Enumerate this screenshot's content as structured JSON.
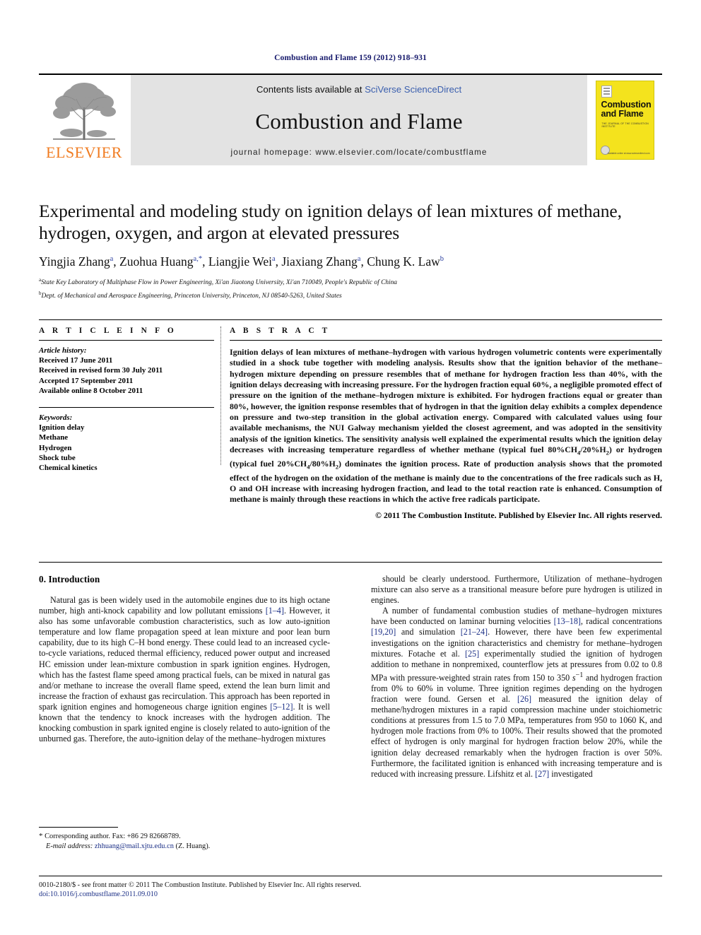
{
  "running_head": "Combustion and Flame 159 (2012) 918–931",
  "banner": {
    "publisher_logo_name": "elsevier-tree-logo",
    "publisher_wordmark": "ELSEVIER",
    "contents_prefix": "Contents lists available at ",
    "contents_link": "SciVerse ScienceDirect",
    "journal_title": "Combustion and Flame",
    "homepage": "journal homepage: www.elsevier.com/locate/combustflame",
    "cover": {
      "title_line1": "Combustion",
      "title_line2": "and Flame",
      "subtitle": "THE JOURNAL OF THE COMBUSTION INSTITUTE",
      "footer_note": "Available online at www.sciencedirect.com"
    }
  },
  "article": {
    "title": "Experimental and modeling study on ignition delays of lean mixtures of methane, hydrogen, oxygen, and argon at elevated pressures",
    "authors_html": "Yingjia Zhang<sup>a</sup>, Zuohua Huang<sup>a,</sup><sup>*</sup>, Liangjie Wei<sup>a</sup>, Jiaxiang Zhang<sup>a</sup>, Chung K. Law<sup>b</sup>",
    "affiliations": [
      {
        "marker": "a",
        "text": "State Key Laboratory of Multiphase Flow in Power Engineering, Xi'an Jiaotong University, Xi'an 710049, People's Republic of China"
      },
      {
        "marker": "b",
        "text": "Dept. of Mechanical and Aerospace Engineering, Princeton University, Princeton, NJ 08540-5263, United States"
      }
    ]
  },
  "info": {
    "heading": "A R T I C L E   I N F O",
    "history_label": "Article history:",
    "history": [
      "Received 17 June 2011",
      "Received in revised form 30 July 2011",
      "Accepted 17 September 2011",
      "Available online 8 October 2011"
    ],
    "keywords_label": "Keywords:",
    "keywords": [
      "Ignition delay",
      "Methane",
      "Hydrogen",
      "Shock tube",
      "Chemical kinetics"
    ]
  },
  "abstract": {
    "heading": "A B S T R A C T",
    "body_html": "Ignition delays of lean mixtures of methane–hydrogen with various hydrogen volumetric contents were experimentally studied in a shock tube together with modeling analysis. Results show that the ignition behavior of the methane–hydrogen mixture depending on pressure resembles that of methane for hydrogen fraction less than 40%, with the ignition delays decreasing with increasing pressure. For the hydrogen fraction equal 60%, a negligible promoted effect of pressure on the ignition of the methane–hydrogen mixture is exhibited. For hydrogen fractions equal or greater than 80%, however, the ignition response resembles that of hydrogen in that the ignition delay exhibits a complex dependence on pressure and two-step transition in the global activation energy. Compared with calculated values using four available mechanisms, the NUI Galway mechanism yielded the closest agreement, and was adopted in the sensitivity analysis of the ignition kinetics. The sensitivity analysis well explained the experimental results which the ignition delay decreases with increasing temperature regardless of whether methane (typical fuel 80%CH<sub>4</sub>/20%H<sub>2</sub>) or hydrogen (typical fuel 20%CH<sub>4</sub>/80%H<sub>2</sub>) dominates the ignition process. Rate of production analysis shows that the promoted effect of the hydrogen on the oxidation of the methane is mainly due to the concentrations of the free radicals such as H, O and OH increase with increasing hydrogen fraction, and lead to the total reaction rate is enhanced. Consumption of methane is mainly through these reactions in which the active free radicals participate.",
    "copyright": "© 2011 The Combustion Institute. Published by Elsevier Inc. All rights reserved."
  },
  "intro": {
    "heading": "0. Introduction",
    "left_paragraphs_html": [
      "Natural gas is been widely used in the automobile engines due to its high octane number, high anti-knock capability and low pollutant emissions <span class=\"ref\">[1–4]</span>. However, it also has some unfavorable combustion characteristics, such as low auto-ignition temperature and low flame propagation speed at lean mixture and poor lean burn capability, due to its high C–H bond energy. These could lead to an increased cycle-to-cycle variations, reduced thermal efficiency, reduced power output and increased HC emission under lean-mixture combustion in spark ignition engines. Hydrogen, which has the fastest flame speed among practical fuels, can be mixed in natural gas and/or methane to increase the overall flame speed, extend the lean burn limit and increase the fraction of exhaust gas recirculation. This approach has been reported in spark ignition engines and homogeneous charge ignition engines <span class=\"ref\">[5–12]</span>. It is well known that the tendency to knock increases with the hydrogen addition. The knocking combustion in spark ignited engine is closely related to auto-ignition of the unburned gas. Therefore, the auto-ignition delay of the methane–hydrogen mixtures"
    ],
    "right_paragraphs_html": [
      "should be clearly understood. Furthermore, Utilization of methane–hydrogen mixture can also serve as a transitional measure before pure hydrogen is utilized in engines.",
      "A number of fundamental combustion studies of methane–hydrogen mixtures have been conducted on laminar burning velocities <span class=\"ref\">[13–18]</span>, radical concentrations <span class=\"ref\">[19,20]</span> and simulation <span class=\"ref\">[21–24]</span>. However, there have been few experimental investigations on the ignition characteristics and chemistry for methane–hydrogen mixtures. Fotache et al. <span class=\"ref\">[25]</span> experimentally studied the ignition of hydrogen addition to methane in nonpremixed, counterflow jets at pressures from 0.02 to 0.8 MPa with pressure-weighted strain rates from 150 to 350 <em>s</em><sup>−1</sup> and hydrogen fraction from 0% to 60% in volume. Three ignition regimes depending on the hydrogen fraction were found. Gersen et al. <span class=\"ref\">[26]</span> measured the ignition delay of methane/hydrogen mixtures in a rapid compression machine under stoichiometric conditions at pressures from 1.5 to 7.0 MPa, temperatures from 950 to 1060 K, and hydrogen mole fractions from 0% to 100%. Their results showed that the promoted effect of hydrogen is only marginal for hydrogen fraction below 20%, while the ignition delay decreased remarkably when the hydrogen fraction is over 50%. Furthermore, the facilitated ignition is enhanced with increasing temperature and is reduced with increasing pressure. Lifshitz et al. <span class=\"ref\">[27]</span> investigated"
    ]
  },
  "footnote": {
    "corresponding_html": "<span class=\"star\">*</span> Corresponding author. Fax: +86 29 82668789.",
    "email_label": "E-mail address:",
    "email": "zhhuang@mail.xjtu.edu.cn",
    "email_suffix": "(Z. Huang)."
  },
  "footer": {
    "line1": "0010-2180/$ - see front matter © 2011 The Combustion Institute. Published by Elsevier Inc. All rights reserved.",
    "doi_label": "doi:",
    "doi": "10.1016/j.combustflame.2011.09.010"
  },
  "colors": {
    "link": "#1b2f86",
    "elsevier_orange": "#f07c22",
    "cover_yellow": "#f4e31d",
    "banner_grey": "#e3e3e3",
    "runhead_blue": "#15186b"
  }
}
